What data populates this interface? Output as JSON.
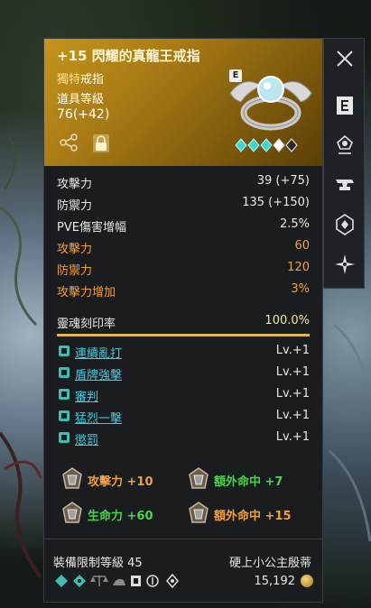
{
  "item": {
    "title": "+15 閃耀的真龍王戒指",
    "rarity": "獨特",
    "type": "戒指",
    "level_label": "道具等級",
    "level_value": "76(+42)",
    "badge": "E"
  },
  "stats": [
    {
      "label": "攻擊力",
      "value": "39 (+75)",
      "style": "white"
    },
    {
      "label": "防禦力",
      "value": "135 (+150)",
      "style": "white"
    },
    {
      "label": "PVE傷害增幅",
      "value": "2.5%",
      "style": "white"
    },
    {
      "label": "攻擊力",
      "value": "60",
      "style": "orange"
    },
    {
      "label": "防禦力",
      "value": "120",
      "style": "orange"
    },
    {
      "label": "攻擊力增加",
      "value": "3%",
      "style": "orange"
    }
  ],
  "soul": {
    "label": "靈魂刻印率",
    "value": "100.0%",
    "fill": 1.0
  },
  "skills": [
    {
      "name": "連續亂打",
      "level": "Lv.+1"
    },
    {
      "name": "盾牌強擊",
      "level": "Lv.+1"
    },
    {
      "name": "審判",
      "level": "Lv.+1"
    },
    {
      "name": "猛烈一擊",
      "level": "Lv.+1"
    },
    {
      "name": "懲罰",
      "level": "Lv.+1"
    }
  ],
  "bonuses": [
    {
      "text": "攻擊力 +10",
      "color": "#f0a040"
    },
    {
      "text": "額外命中 +7",
      "color": "#4cd24c"
    },
    {
      "text": "生命力 +60",
      "color": "#4cd24c"
    },
    {
      "text": "額外命中 +15",
      "color": "#f0a040"
    }
  ],
  "footer": {
    "required_level": "裝備限制等級 45",
    "owner": "硬上小公主殷蒂",
    "price": "15,192"
  },
  "side_buttons": [
    "close-icon",
    "enchant-e-icon",
    "skill-stone-icon",
    "anvil-icon",
    "soul-crystal-icon",
    "compass-star-icon"
  ],
  "colors": {
    "header_gold": "#c3951d",
    "orange": "#f0a040",
    "green": "#4cd24c",
    "skill_cyan": "#4cc8dd"
  }
}
